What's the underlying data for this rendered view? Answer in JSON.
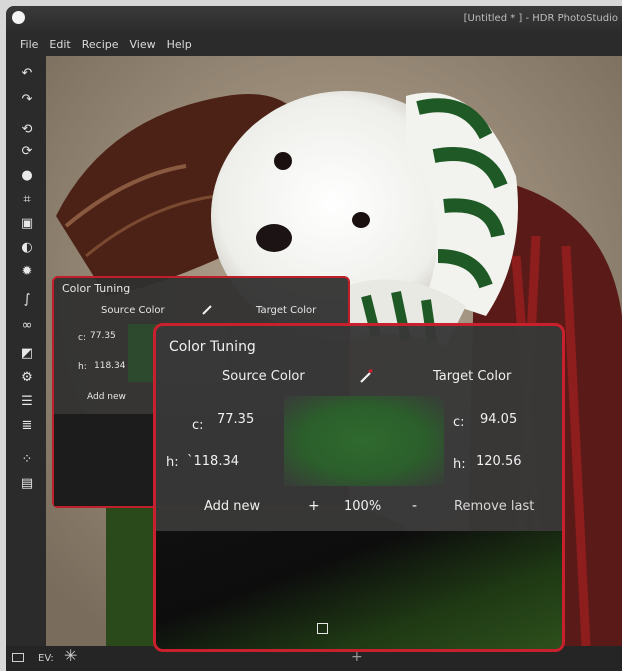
{
  "window": {
    "title": "[Untitled * ] - HDR PhotoStudio"
  },
  "menu": {
    "items": [
      "File",
      "Edit",
      "Recipe",
      "View",
      "Help"
    ]
  },
  "toolbar": {
    "tools": [
      "undo-icon",
      "redo-icon",
      "rotate-left-icon",
      "rotate-right-icon",
      "brush-icon",
      "crop-icon",
      "image-icon",
      "drop-icon",
      "sun-icon",
      "curve-icon",
      "glasses-icon",
      "palette-icon",
      "adjust-icon",
      "sliders-icon",
      "levels-icon",
      "rain-icon",
      "document-icon"
    ]
  },
  "status": {
    "ev_label": "EV:"
  },
  "color_tuning_small": {
    "title": "Color Tuning",
    "source_label": "Source Color",
    "target_label": "Target Color",
    "c_label": "c:",
    "c_value": "77.35",
    "h_label": "h:",
    "h_value": "118.34",
    "add_new": "Add new"
  },
  "color_tuning": {
    "title": "Color Tuning",
    "source_label": "Source Color",
    "target_label": "Target Color",
    "source_c_label": "c:",
    "source_c_value": "77.35",
    "source_h_label": "h:",
    "source_h_value": "`118.34",
    "target_c_label": "c:",
    "target_c_value": "94.05",
    "target_h_label": "h:",
    "target_h_value": "120.56",
    "add_new": "Add new",
    "plus": "+",
    "percent": "100%",
    "minus": "-",
    "remove_last": "Remove last",
    "swatch_color": "#2f6a2f"
  },
  "colors": {
    "highlight_border": "#c8202c",
    "panel_bg": "#383838"
  }
}
